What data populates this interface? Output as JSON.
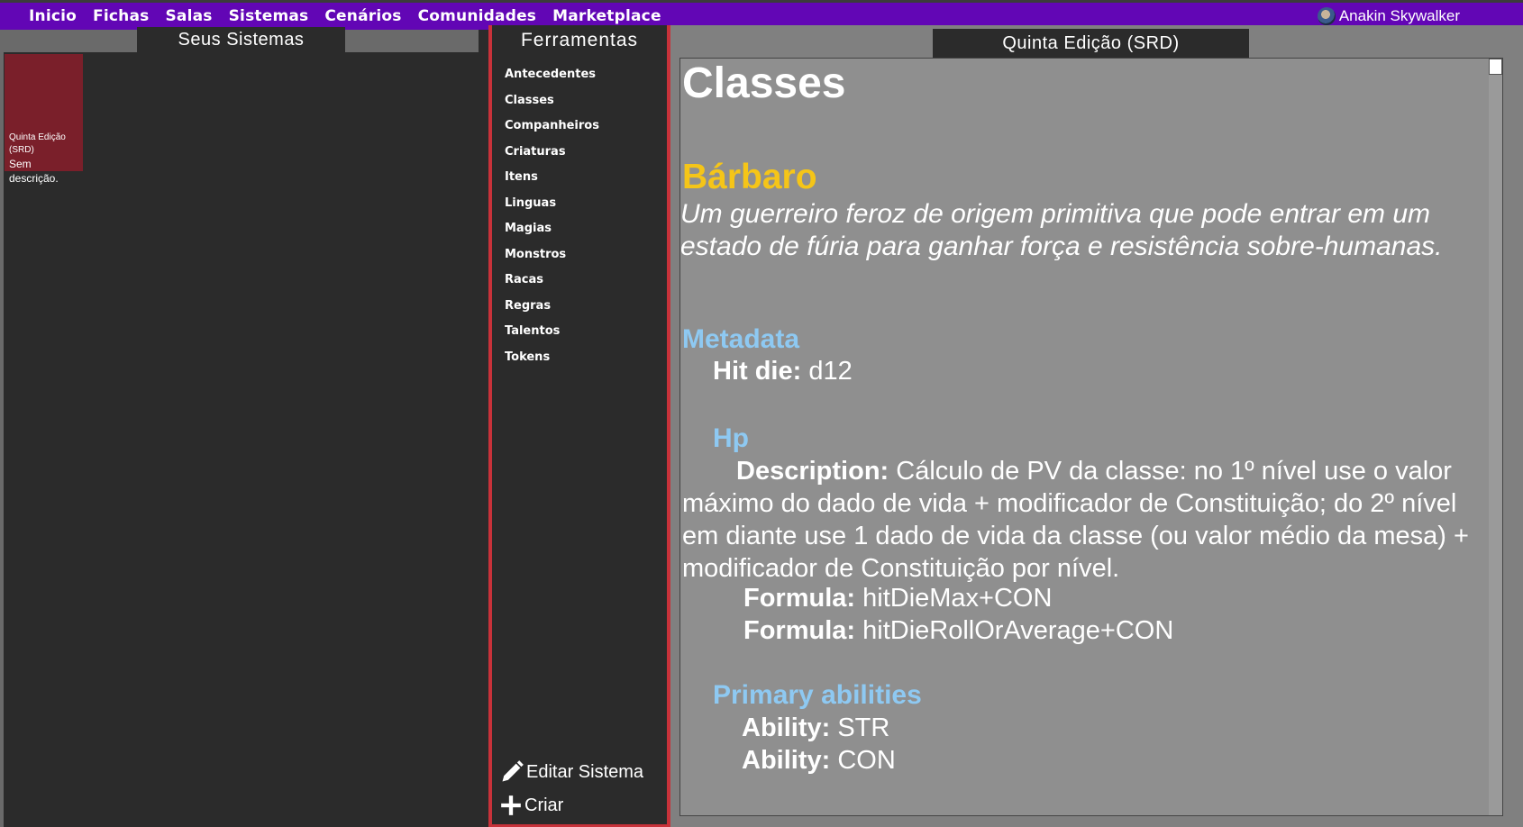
{
  "nav": {
    "items": [
      "Inicio",
      "Fichas",
      "Salas",
      "Sistemas",
      "Cenários",
      "Comunidades",
      "Marketplace"
    ],
    "user": "Anakin Skywalker"
  },
  "systems": {
    "title": "Seus Sistemas",
    "card": {
      "name": "Quinta Edição (SRD)",
      "description": "Sem descrição."
    }
  },
  "tools": {
    "title": "Ferramentas",
    "items": [
      "Antecedentes",
      "Classes",
      "Companheiros",
      "Criaturas",
      "Itens",
      "Linguas",
      "Magias",
      "Monstros",
      "Racas",
      "Regras",
      "Talentos",
      "Tokens"
    ],
    "edit_label": "Editar Sistema",
    "create_label": "Criar"
  },
  "viewer": {
    "tab": "Quinta Edição (SRD)",
    "heading": "Classes",
    "class_name": "Bárbaro",
    "class_desc": "Um guerreiro feroz de origem primitiva que pode entrar em um estado de fúria para ganhar força e resistência sobre-humanas.",
    "metadata_label": "Metadata",
    "hit_die_key": "Hit die:",
    "hit_die_val": "d12",
    "hp_label": "Hp",
    "desc_key": "Description:",
    "desc_val": "Cálculo de PV da classe: no 1º nível use o valor máximo do dado de vida + modificador de Constituição; do 2º nível em diante use 1 dado de vida da classe (ou valor médio da mesa) + modificador de Constituição por nível.",
    "formula_key": "Formula:",
    "formula_1": "hitDieMax+CON",
    "formula_2": "hitDieRollOrAverage+CON",
    "primary_label": "Primary abilities",
    "ability_key": "Ability:",
    "ability_1": "STR",
    "ability_2": "CON"
  }
}
